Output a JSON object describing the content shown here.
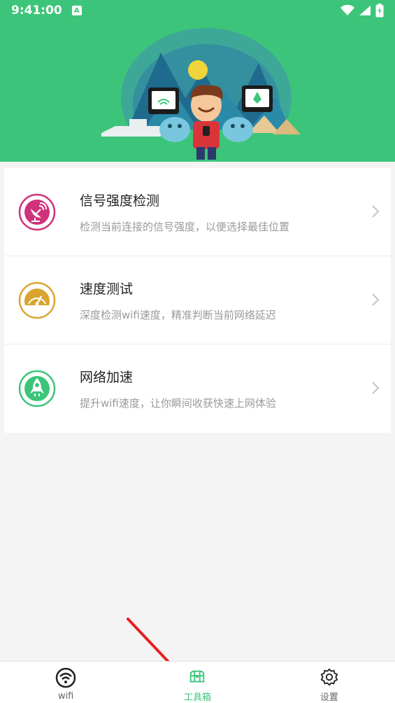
{
  "status_bar": {
    "time": "9:41:00",
    "notification_letter": "A"
  },
  "tools": [
    {
      "title": "信号强度检测",
      "description": "检测当前连接的信号强度，以便选择最佳位置",
      "icon": "satellite-dish-icon",
      "color": "#d0317b"
    },
    {
      "title": "速度测试",
      "description": "深度检测wifi速度，精准判断当前网络延迟",
      "icon": "speedometer-icon",
      "color": "#d9a530"
    },
    {
      "title": "网络加速",
      "description": "提升wifi速度，让你瞬间收获快速上网体验",
      "icon": "rocket-icon",
      "color": "#3cc57a"
    }
  ],
  "bottom_nav": [
    {
      "label": "wifi",
      "icon": "wifi-icon",
      "active": false
    },
    {
      "label": "工具箱",
      "icon": "toolbox-icon",
      "active": true
    },
    {
      "label": "设置",
      "icon": "gear-icon",
      "active": false
    }
  ],
  "colors": {
    "accent": "#3cc57a",
    "annotation": "#e8201f"
  }
}
